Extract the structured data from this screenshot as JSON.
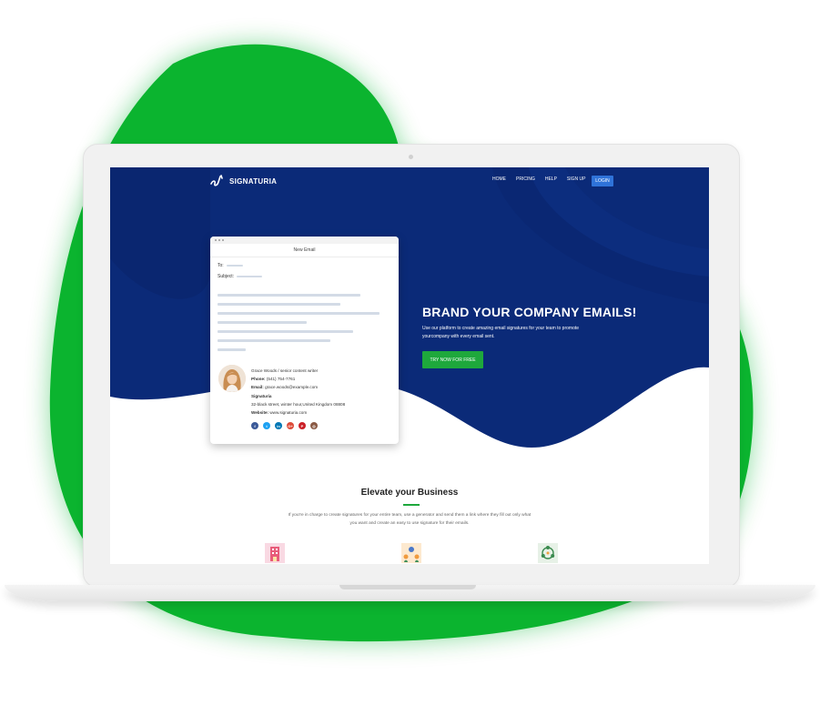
{
  "brand": {
    "name": "SIGNATURIA"
  },
  "nav": {
    "items": [
      {
        "label": "HOME"
      },
      {
        "label": "PRICING"
      },
      {
        "label": "HELP"
      },
      {
        "label": "SIGN UP"
      }
    ],
    "login": "LOGIN"
  },
  "email_card": {
    "title": "New Email",
    "to_label": "To:",
    "subject_label": "Subject:",
    "signature": {
      "name": "Grace Woods",
      "separator": "/",
      "role": "senior content writer",
      "phone_label": "Phone:",
      "phone": "(541) 754-7761",
      "email_label": "Email:",
      "email": "grace.woods@example.com",
      "company": "Signaturia",
      "address": "32-black street, winter hour,United Kingdom 08808",
      "website_label": "Website:",
      "website": "www.signaturia.com"
    },
    "socials": [
      {
        "icon": "facebook-icon",
        "glyph": "f",
        "color": "#3b5998"
      },
      {
        "icon": "twitter-icon",
        "glyph": "t",
        "color": "#1da1f2"
      },
      {
        "icon": "linkedin-icon",
        "glyph": "in",
        "color": "#0077b5"
      },
      {
        "icon": "google-plus-icon",
        "glyph": "G+",
        "color": "#dd4b39"
      },
      {
        "icon": "pinterest-icon",
        "glyph": "P",
        "color": "#cb2027"
      },
      {
        "icon": "instagram-icon",
        "glyph": "◎",
        "color": "#8a5a44"
      }
    ]
  },
  "hero": {
    "title": "BRAND YOUR COMPANY EMAILS!",
    "subtitle": "Use our platform to create amazing email signatures for your team to promote yourcompany with every email sent.",
    "cta": "TRY NOW FOR FREE"
  },
  "section": {
    "title": "Elevate your Business",
    "text": "If you're in charge to create signatures for your entire team, use a generator and send them a link where they fill out only what you want and create an easy to use signature for their emails."
  },
  "features": [
    {
      "icon": "building-icon"
    },
    {
      "icon": "team-icon"
    },
    {
      "icon": "network-icon"
    }
  ],
  "colors": {
    "blob": "#0bb42f",
    "hero_bg": "#0b2a78",
    "accent": "#1ea83c",
    "login_bg": "#2f73d9"
  }
}
